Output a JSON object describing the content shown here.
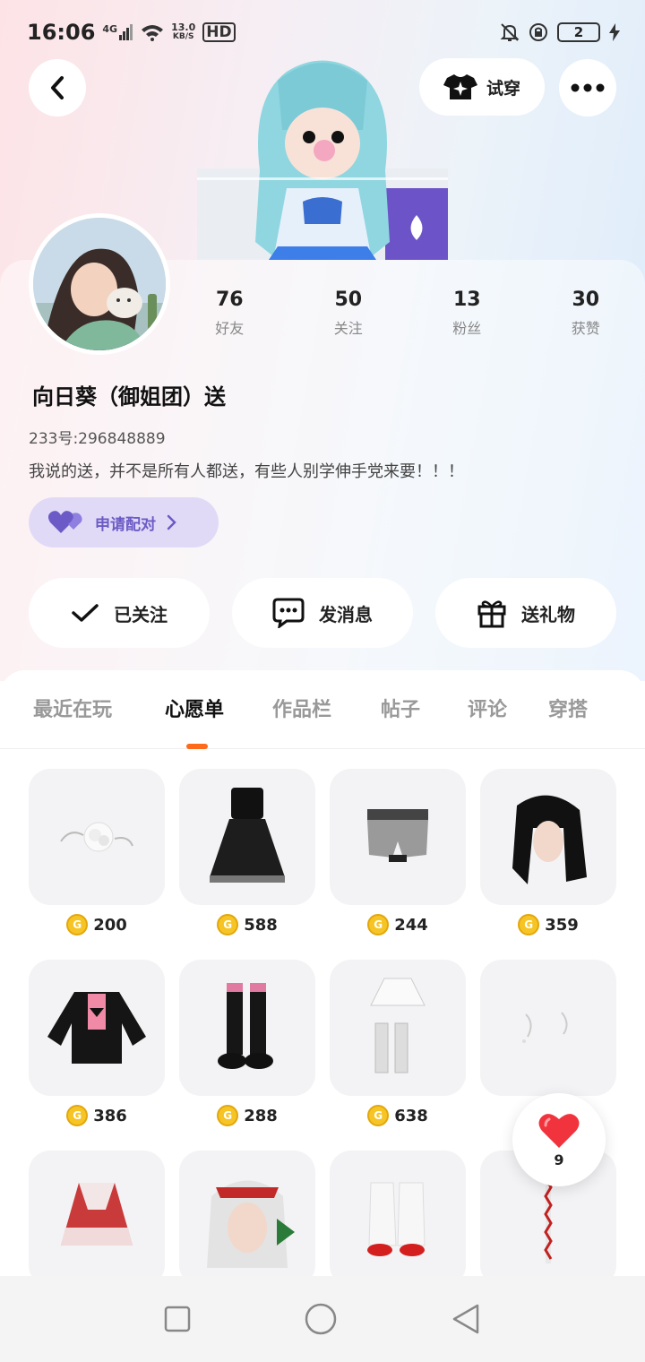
{
  "status_bar": {
    "time": "16:06",
    "network": "4G",
    "speed_value": "13.0",
    "speed_unit": "KB/S",
    "hd": "HD",
    "battery": "2"
  },
  "header": {
    "back_icon": "chevron-left-icon",
    "tryon_label": "试穿",
    "more_icon": "more-dots-icon"
  },
  "profile": {
    "stats": [
      {
        "value": "76",
        "label": "好友"
      },
      {
        "value": "50",
        "label": "关注"
      },
      {
        "value": "13",
        "label": "粉丝"
      },
      {
        "value": "30",
        "label": "获赞"
      }
    ],
    "nickname": "向日葵（御姐团）送",
    "user_id": "233号:296848889",
    "bio": "我说的送，并不是所有人都送，有些人别学伸手党来要！！！",
    "pair_button": "申请配对"
  },
  "actions": {
    "follow": "已关注",
    "message": "发消息",
    "gift": "送礼物"
  },
  "tabs": [
    "最近在玩",
    "心愿单",
    "作品栏",
    "帖子",
    "评论",
    "穿搭"
  ],
  "active_tab": "心愿单",
  "items": [
    {
      "name": "hair-accessory",
      "price": "200"
    },
    {
      "name": "black-dress",
      "price": "588"
    },
    {
      "name": "shorts",
      "price": "244"
    },
    {
      "name": "black-hair",
      "price": "359"
    },
    {
      "name": "leather-jacket",
      "price": "386"
    },
    {
      "name": "boots",
      "price": "288"
    },
    {
      "name": "white-skirt",
      "price": "638"
    },
    {
      "name": "sparkle-accessory",
      "price": ""
    },
    {
      "name": "red-dress",
      "price": ""
    },
    {
      "name": "white-hair",
      "price": ""
    },
    {
      "name": "fluffy-boots",
      "price": ""
    },
    {
      "name": "candy-wand",
      "price": ""
    }
  ],
  "like": {
    "count": "9"
  },
  "colors": {
    "accent": "#ff6a1a",
    "pair_bg": "#e1daf7",
    "pair_text": "#6c5bc6",
    "coin": "#f6c525"
  }
}
